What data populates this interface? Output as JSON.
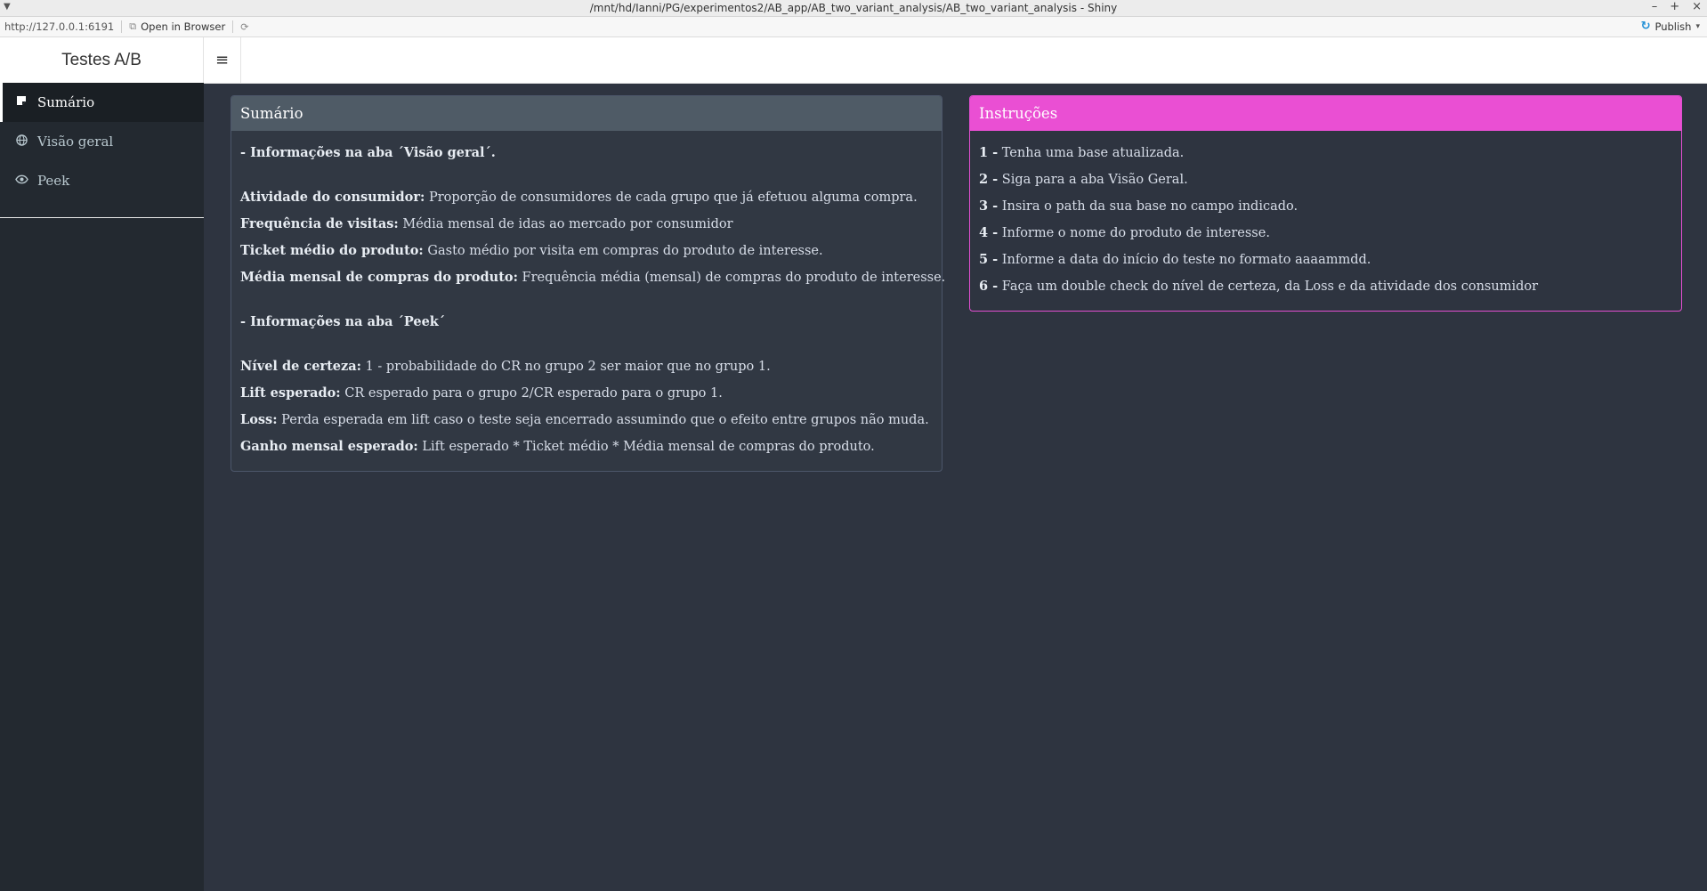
{
  "window": {
    "title": "/mnt/hd/Ianni/PG/experimentos2/AB_app/AB_two_variant_analysis/AB_two_variant_analysis - Shiny",
    "controls": [
      "–",
      "+",
      "×"
    ]
  },
  "toolbar": {
    "url": "http://127.0.0.1:6191",
    "open_in_browser": "Open in Browser",
    "publish": "Publish"
  },
  "header": {
    "brand": "Testes A/B"
  },
  "sidebar": {
    "items": [
      {
        "label": "Sumário",
        "icon": "sticky-note-icon",
        "active": true
      },
      {
        "label": "Visão geral",
        "icon": "globe-icon",
        "active": false
      },
      {
        "label": "Peek",
        "icon": "eye-icon",
        "active": false
      }
    ]
  },
  "summary_box": {
    "title": "Sumário",
    "section1_heading": "- Informações na aba ´Visão geral´.",
    "section1_items": [
      {
        "term": "Atividade do consumidor:",
        "desc": " Proporção de consumidores de cada grupo que já efetuou alguma compra."
      },
      {
        "term": "Frequência de visitas:",
        "desc": " Média mensal de idas ao mercado por consumidor"
      },
      {
        "term": "Ticket médio do produto:",
        "desc": " Gasto médio por visita em compras do produto de interesse."
      },
      {
        "term": "Média mensal de compras do produto:",
        "desc": " Frequência média (mensal) de compras do produto de interesse."
      }
    ],
    "section2_heading": "- Informações na aba ´Peek´",
    "section2_items": [
      {
        "term": "Nível de certeza:",
        "desc": " 1 - probabilidade do CR no grupo 2 ser maior que no grupo 1."
      },
      {
        "term": "Lift esperado:",
        "desc": " CR esperado para o grupo 2/CR esperado para o grupo 1."
      },
      {
        "term": "Loss:",
        "desc": " Perda esperada em lift caso o teste seja encerrado assumindo que o efeito entre grupos não muda."
      },
      {
        "term": "Ganho mensal esperado:",
        "desc": " Lift esperado * Ticket médio * Média mensal de compras do produto."
      }
    ]
  },
  "instructions_box": {
    "title": "Instruções",
    "steps": [
      {
        "num": "1 -",
        "text": " Tenha uma base atualizada."
      },
      {
        "num": "2 -",
        "text": " Siga para a aba Visão Geral."
      },
      {
        "num": "3 -",
        "text": " Insira o path da sua base no campo indicado."
      },
      {
        "num": "4 -",
        "text": " Informe o nome do produto de interesse."
      },
      {
        "num": "5 -",
        "text": " Informe a data do início do teste no formato aaaammdd."
      },
      {
        "num": "6 -",
        "text": " Faça um double check do nível de certeza, da Loss e da atividade dos consumidor"
      }
    ]
  },
  "colors": {
    "background": "#2e3440",
    "sidebar": "#232930",
    "instructions_accent": "#ea4fd3",
    "summary_header": "#4f5b66"
  }
}
